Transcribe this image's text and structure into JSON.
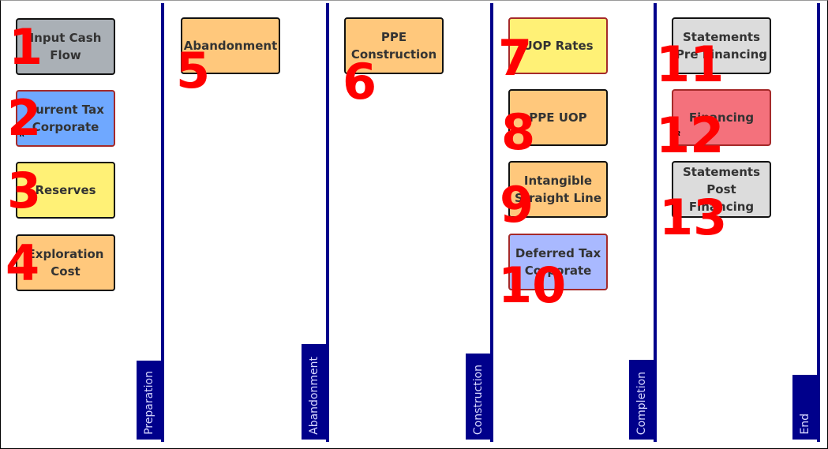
{
  "lanes": [
    {
      "label": "Preparation"
    },
    {
      "label": "Abandonment"
    },
    {
      "label": "Construction"
    },
    {
      "label": "Completion"
    },
    {
      "label": "End"
    }
  ],
  "boxes": [
    {
      "label": "Input Cash Flow",
      "number": "1",
      "color": "#aab0b6"
    },
    {
      "label": "Current Tax Corporate",
      "number": "2",
      "color": "#6fa8ff",
      "marker": "R"
    },
    {
      "label": "Reserves",
      "number": "3",
      "color": "#fff176"
    },
    {
      "label": "Exploration Cost",
      "number": "4",
      "color": "#ffc87c"
    },
    {
      "label": "Abandonment",
      "number": "5",
      "color": "#ffc87c"
    },
    {
      "label": "PPE Construction",
      "number": "6",
      "color": "#ffc87c"
    },
    {
      "label": "UOP Rates",
      "number": "7",
      "color": "#fff176"
    },
    {
      "label": "PPE UOP",
      "number": "8",
      "color": "#ffc87c"
    },
    {
      "label": "Intangible Straight Line",
      "number": "9",
      "color": "#ffc87c"
    },
    {
      "label": "Deferred Tax Corporate",
      "number": "10",
      "color": "#a9b9ff"
    },
    {
      "label": "Statements Pre Financing",
      "number": "11",
      "color": "#dcdcdc"
    },
    {
      "label": "Financing",
      "number": "12",
      "color": "#f4717c",
      "marker": "R"
    },
    {
      "label": "Statements Post Financing",
      "number": "13",
      "color": "#dcdcdc"
    }
  ],
  "colors": {
    "lane_line": "#00008b",
    "number": "#ff0000"
  }
}
